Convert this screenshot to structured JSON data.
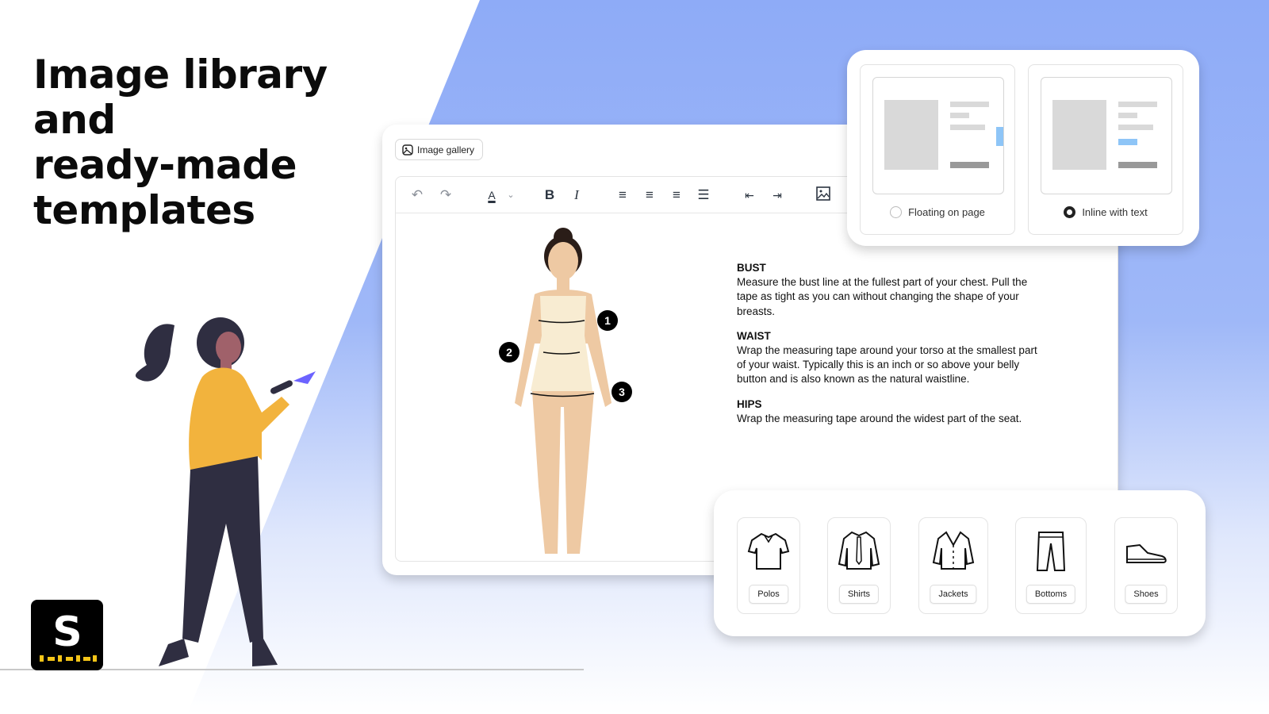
{
  "headline": [
    "Image library and",
    "ready-made",
    "templates"
  ],
  "editor": {
    "gallery_button": "Image gallery",
    "toolbar": [
      "undo-icon",
      "redo-icon",
      "text-color-icon",
      "chevron-down-icon",
      "bold-icon",
      "italic-icon",
      "align-left-icon",
      "align-center-icon",
      "align-right-icon",
      "align-justify-icon",
      "outdent-icon",
      "indent-icon",
      "image-icon"
    ],
    "text_color_letter": "A",
    "bold_letter": "B",
    "italic_letter": "I",
    "markers": [
      "1",
      "2",
      "3"
    ],
    "sections": [
      {
        "title": "BUST",
        "text": "Measure the bust line at the fullest part of your chest. Pull the tape as tight as you can without changing the shape of your breasts."
      },
      {
        "title": "WAIST",
        "text": "Wrap the measuring tape around your torso at the smallest part of your waist. Typically this is an inch or so above your belly button and is also known as the natural waistline."
      },
      {
        "title": "HIPS",
        "text": "Wrap the measuring tape around the widest part of the seat."
      }
    ]
  },
  "layout_options": [
    {
      "label": "Floating on page",
      "selected": false
    },
    {
      "label": "Inline with text",
      "selected": true
    }
  ],
  "categories": [
    "Polos",
    "Shirts",
    "Jackets",
    "Bottoms",
    "Shoes"
  ],
  "colors": {
    "background_blue": "#8eabf7",
    "accent_light_blue": "#8ec5f7",
    "shirt_yellow": "#f2b33d",
    "pants_navy": "#2f2e41",
    "logo_yellow": "#f5c518"
  }
}
